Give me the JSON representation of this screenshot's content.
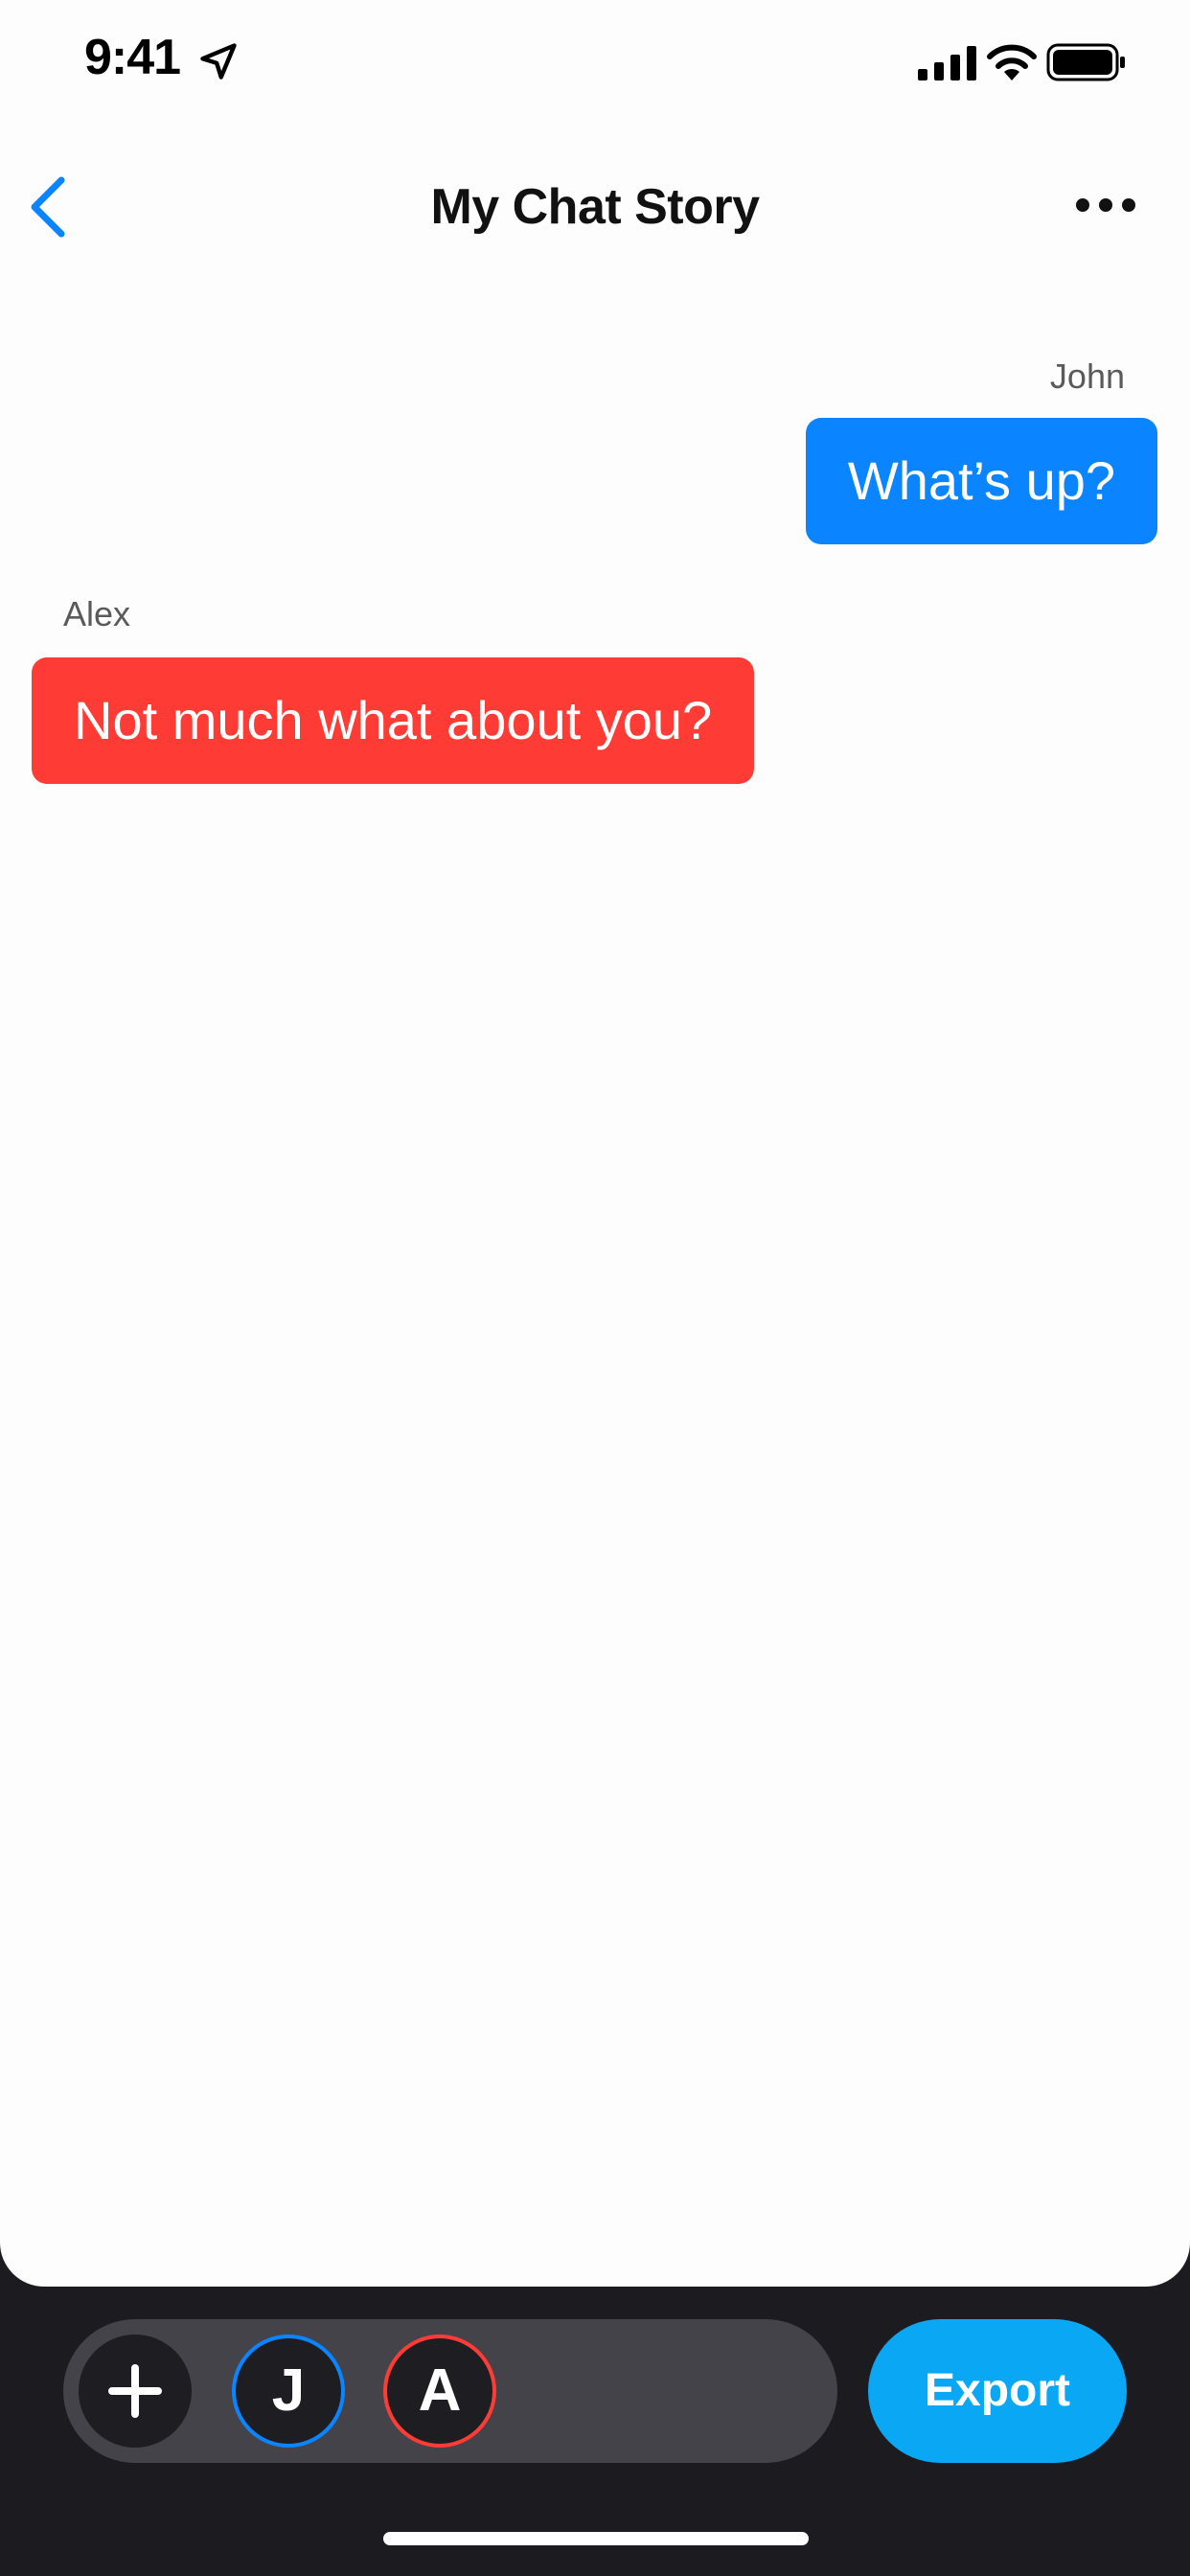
{
  "status_bar": {
    "time": "9:41",
    "icons": [
      "location-arrow-icon",
      "cellular-signal-icon",
      "wifi-icon",
      "battery-icon"
    ]
  },
  "nav": {
    "title": "My Chat Story",
    "back_icon": "chevron-left-icon",
    "more_icon": "ellipsis-icon"
  },
  "messages": [
    {
      "sender": "John",
      "text": "What’s up?",
      "side": "right",
      "color": "#0a84ff"
    },
    {
      "sender": "Alex",
      "text": "Not much what about you?",
      "side": "left",
      "color": "#ff3b35"
    }
  ],
  "toolbar": {
    "add_icon": "plus-icon",
    "participants": [
      {
        "initial": "J",
        "color": "#0a84ff"
      },
      {
        "initial": "A",
        "color": "#ff3b35"
      }
    ],
    "export_label": "Export"
  },
  "colors": {
    "accent": "#0a84ff",
    "export": "#0aa7f5",
    "alex_bubble": "#ff3b35",
    "toolbar_bg": "#1c1b1f"
  }
}
